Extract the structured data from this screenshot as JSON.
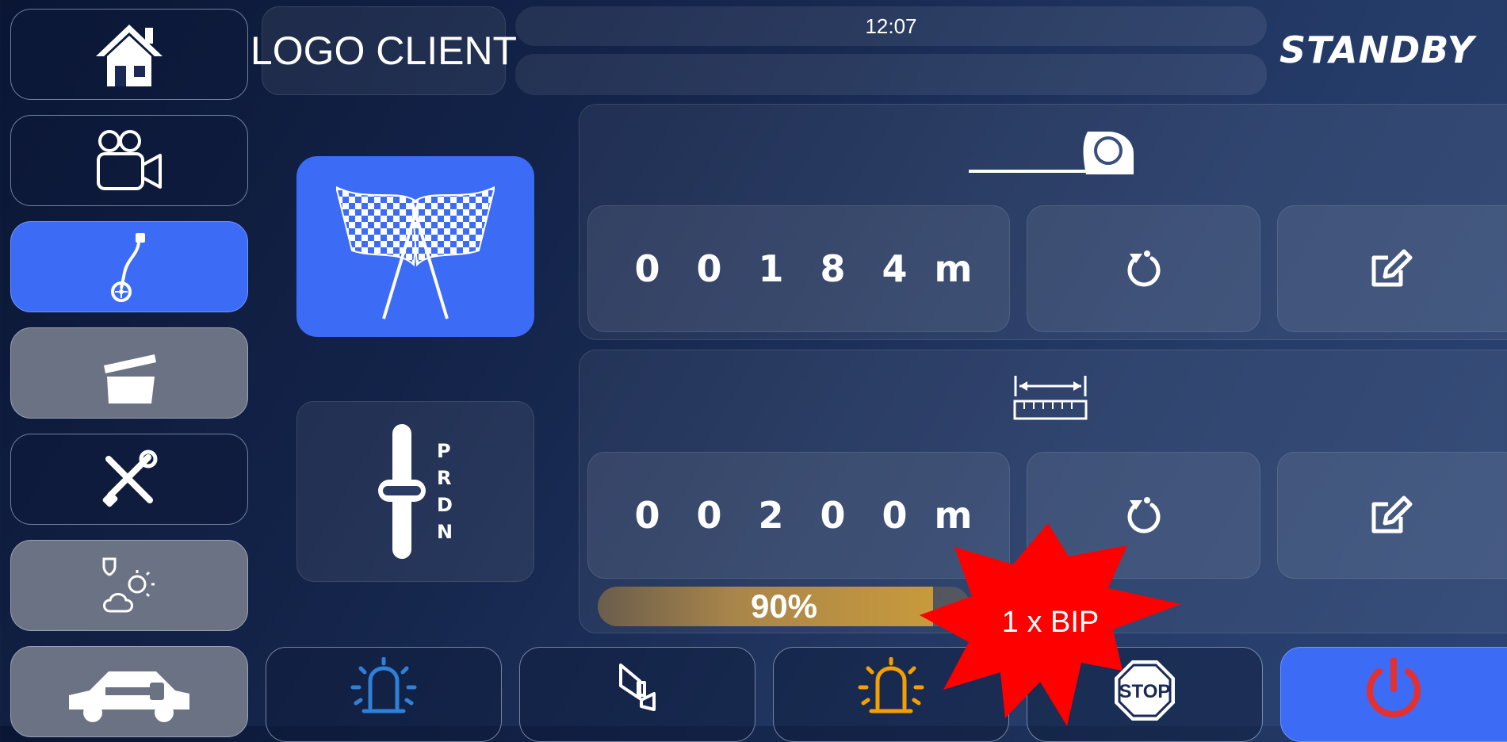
{
  "header": {
    "logo_text": "LOGO CLIENT",
    "time": "12:07",
    "status": "STANDBY"
  },
  "sidebar": {
    "items": [
      {
        "icon": "home-icon"
      },
      {
        "icon": "camera-icon"
      },
      {
        "icon": "measuring-wheel-icon",
        "active": true
      },
      {
        "icon": "clapperboard-icon"
      },
      {
        "icon": "tools-icon"
      },
      {
        "icon": "weather-icon"
      },
      {
        "icon": "car-key-icon"
      }
    ]
  },
  "distance_panel": {
    "icon": "tape-measure-icon",
    "digits": [
      "0",
      "0",
      "1",
      "8",
      "4"
    ],
    "unit": "m"
  },
  "target_panel": {
    "icon": "ruler-icon",
    "digits": [
      "0",
      "0",
      "2",
      "0",
      "0"
    ],
    "unit": "m",
    "progress_label": "90%",
    "progress": 0.9
  },
  "gear": {
    "letters": [
      "P",
      "R",
      "D",
      "N"
    ]
  },
  "alert": {
    "text": "1 x BIP"
  },
  "bottom_bar": {
    "buttons": [
      {
        "icon": "beacon-blue-icon"
      },
      {
        "icon": "horn-icon"
      },
      {
        "icon": "beacon-orange-icon"
      },
      {
        "icon": "stop-sign-icon",
        "label": "STOP"
      },
      {
        "icon": "power-icon"
      }
    ]
  },
  "colors": {
    "accent": "#3c6bf5",
    "alert": "#ff0000",
    "beacon_blue": "#2f80d8",
    "beacon_orange": "#f5a000",
    "power_red": "#e53030",
    "progress": "#c89a3c"
  }
}
